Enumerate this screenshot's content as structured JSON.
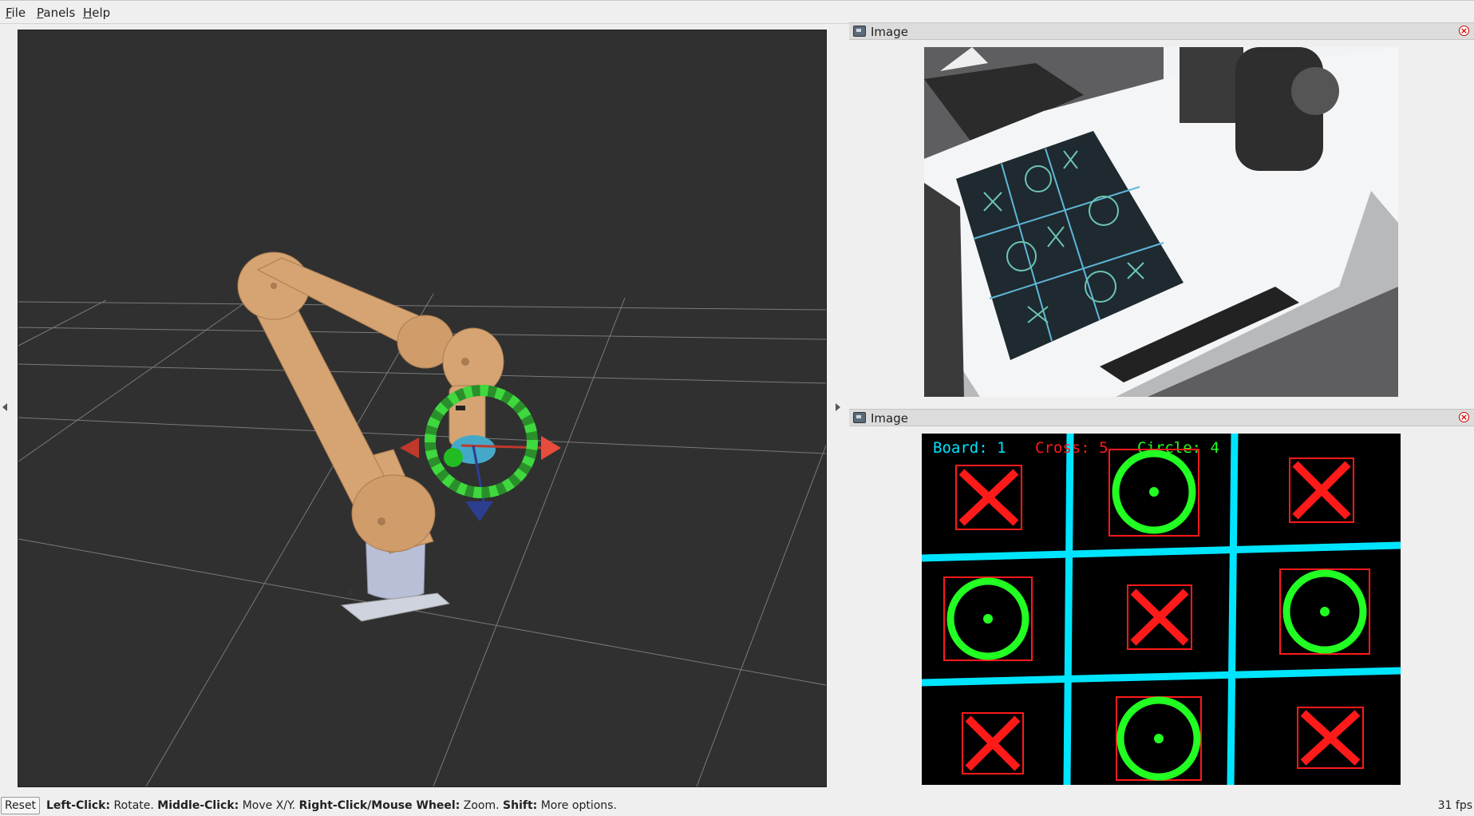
{
  "menubar": {
    "items": [
      {
        "label": "File",
        "accel": "F",
        "rest": "ile"
      },
      {
        "label": "Panels",
        "accel": "P",
        "rest": "anels"
      },
      {
        "label": "Help",
        "accel": "H",
        "rest": "elp"
      }
    ]
  },
  "panels": [
    {
      "title": "Image",
      "close_icon": "close-icon"
    },
    {
      "title": "Image",
      "close_icon": "close-icon"
    }
  ],
  "detection": {
    "board_label": "Board: 1",
    "cross_label": "Cross: 5",
    "circle_label": "Circle: 4",
    "colors": {
      "board": "#00e5ff",
      "cross": "#ff1a1a",
      "circle": "#22ff22"
    }
  },
  "statusbar": {
    "reset_label": "Reset",
    "hints": [
      {
        "key": "Left-Click:",
        "text": " Rotate. "
      },
      {
        "key": "Middle-Click:",
        "text": " Move X/Y. "
      },
      {
        "key": "Right-Click/Mouse Wheel:",
        "text": " Zoom. "
      },
      {
        "key": "Shift:",
        "text": " More options."
      }
    ],
    "fps": "31 fps"
  },
  "colors": {
    "viewport_bg": "#303030",
    "robot": "#d6a472",
    "grid": "#7a7a7a"
  }
}
